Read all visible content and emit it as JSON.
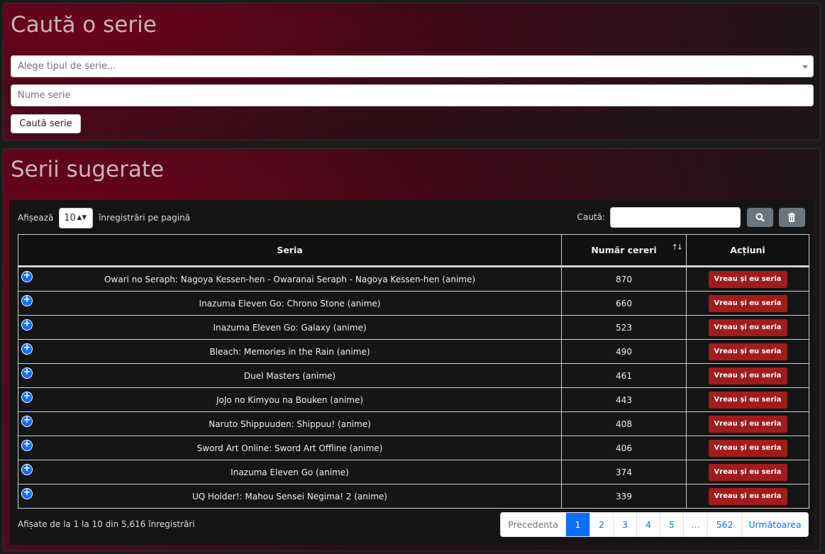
{
  "search_card": {
    "title": "Caută o serie",
    "type_select_placeholder": "Alege tipul de serie...",
    "name_placeholder": "Nume serie",
    "submit_label": "Caută serie"
  },
  "suggest_card": {
    "title": "Serii sugerate",
    "length_prefix": "Afișează",
    "length_value": "10",
    "length_suffix": "înregistrări pe pagină",
    "search_label": "Caută:",
    "columns": {
      "series": "Seria",
      "count": "Număr cereri",
      "actions": "Acțiuni"
    },
    "action_label": "Vreau și eu seria",
    "rows": [
      {
        "name": "Owari no Seraph: Nagoya Kessen-hen - Owaranai Seraph - Nagoya Kessen-hen (anime)",
        "count": "870"
      },
      {
        "name": "Inazuma Eleven Go: Chrono Stone (anime)",
        "count": "660"
      },
      {
        "name": "Inazuma Eleven Go: Galaxy (anime)",
        "count": "523"
      },
      {
        "name": "Bleach: Memories in the Rain (anime)",
        "count": "490"
      },
      {
        "name": "Duel Masters (anime)",
        "count": "461"
      },
      {
        "name": "JoJo no Kimyou na Bouken (anime)",
        "count": "443"
      },
      {
        "name": "Naruto Shippuuden: Shippuu! (anime)",
        "count": "408"
      },
      {
        "name": "Sword Art Online: Sword Art Offline (anime)",
        "count": "406"
      },
      {
        "name": "Inazuma Eleven Go (anime)",
        "count": "374"
      },
      {
        "name": "UQ Holder!: Mahou Sensei Negima! 2 (anime)",
        "count": "339"
      }
    ],
    "info": "Afișate de la 1 la 10 din 5,616 înregistrări",
    "pagination": {
      "prev": "Precedenta",
      "pages": [
        "1",
        "2",
        "3",
        "4",
        "5"
      ],
      "ellipsis": "…",
      "last": "562",
      "next": "Următoarea",
      "active": "1"
    }
  },
  "colors": {
    "accent_red": "#a11c1c",
    "link_orange": "#e8522a",
    "primary_blue": "#0d6efd"
  }
}
